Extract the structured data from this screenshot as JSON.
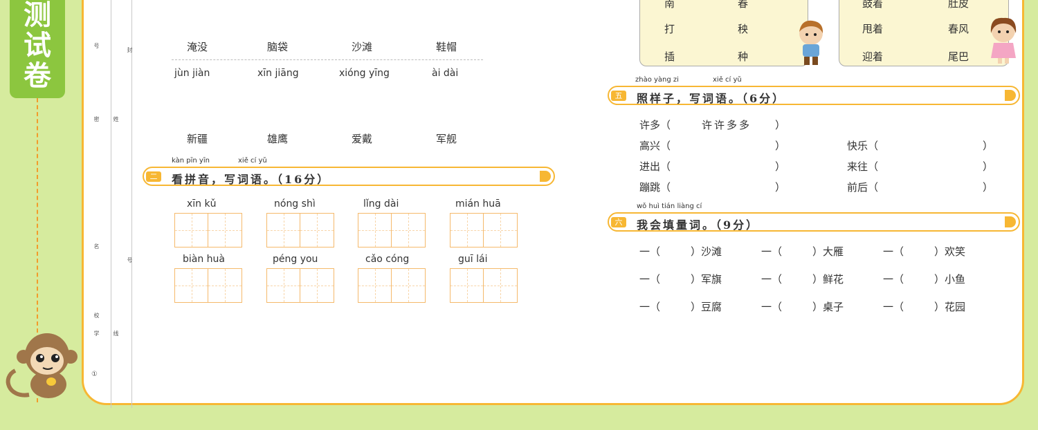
{
  "tab": {
    "chars": [
      "测",
      "试",
      "卷"
    ]
  },
  "binding_strip": {
    "marks": [
      "号",
      "密",
      "姓",
      "名",
      "封",
      "号",
      "线",
      "校",
      "学",
      "①"
    ]
  },
  "section_prev": {
    "words_row1": [
      "淹没",
      "脑袋",
      "沙滩",
      "鞋帽"
    ],
    "pinyin_row": [
      "jùn  jiàn",
      "xīn  jiāng",
      "xióng  yīng",
      "ài  dài"
    ],
    "words_row2": [
      "新疆",
      "雄鹰",
      "爱戴",
      "军舰"
    ]
  },
  "section2": {
    "pinyin_header": [
      "kàn pīn yīn",
      "xiě  cí  yǔ"
    ],
    "number": "二",
    "title": "看拼音，写词语。（16分）",
    "row1": [
      "xīn  kǔ",
      "nóng  shì",
      "lǐng  dài",
      "mián  huā"
    ],
    "row2": [
      "biàn  huà",
      "péng  you",
      "cǎo  cóng",
      "guī  lái"
    ]
  },
  "box_left": {
    "rows": [
      [
        "南",
        "春"
      ],
      [
        "打",
        "秧"
      ],
      [
        "插",
        "种"
      ]
    ]
  },
  "box_right": {
    "rows": [
      [
        "鼓着",
        "肚皮"
      ],
      [
        "甩着",
        "春风"
      ],
      [
        "迎着",
        "尾巴"
      ]
    ]
  },
  "section5": {
    "pinyin_header": [
      "zhào yàng zi",
      "xiě  cí  yǔ"
    ],
    "number": "五",
    "title": "照样子，写词语。（6分）",
    "example": {
      "word": "许多（",
      "answer": "许许多多",
      "close": "）"
    },
    "left": [
      "高兴（",
      "进出（",
      "蹦跳（"
    ],
    "right": [
      "快乐（",
      "来往（",
      "前后（"
    ],
    "close": "）"
  },
  "section6": {
    "pinyin_header": [
      "wǒ huì tián liàng cí"
    ],
    "number": "六",
    "title": "我会填量词。（9分）",
    "prefix": "一（",
    "rows": [
      [
        "）沙滩",
        "）大雁",
        "）欢笑"
      ],
      [
        "）军旗",
        "）鲜花",
        "）小鱼"
      ],
      [
        "）豆腐",
        "）桌子",
        "）花园"
      ]
    ]
  },
  "colors": {
    "accent": "#f7b733",
    "tab": "#8cc63f",
    "background": "#d6eb9e"
  }
}
